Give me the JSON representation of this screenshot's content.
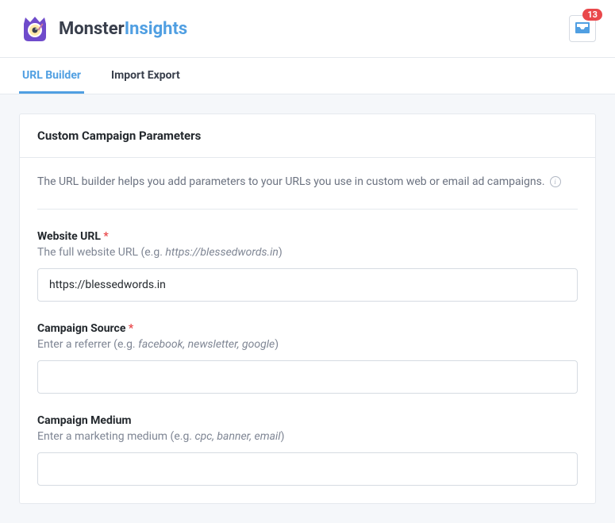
{
  "header": {
    "brand_a": "Monster",
    "brand_b": "Insights",
    "notifications": "13"
  },
  "tabs": [
    {
      "label": "URL Builder",
      "active": true
    },
    {
      "label": "Import Export",
      "active": false
    }
  ],
  "panel": {
    "title": "Custom Campaign Parameters",
    "intro": "The URL builder helps you add parameters to your URLs you use in custom web or email ad campaigns."
  },
  "fields": {
    "website_url": {
      "label": "Website URL",
      "required": true,
      "help_pre": "The full website URL (e.g. ",
      "help_em": "https://blessedwords.in",
      "help_post": ")",
      "value": "https://blessedwords.in"
    },
    "campaign_source": {
      "label": "Campaign Source",
      "required": true,
      "help_pre": "Enter a referrer (e.g. ",
      "help_em": "facebook, newsletter, google",
      "help_post": ")",
      "value": ""
    },
    "campaign_medium": {
      "label": "Campaign Medium",
      "required": false,
      "help_pre": "Enter a marketing medium (e.g. ",
      "help_em": "cpc, banner, email",
      "help_post": ")",
      "value": ""
    }
  }
}
